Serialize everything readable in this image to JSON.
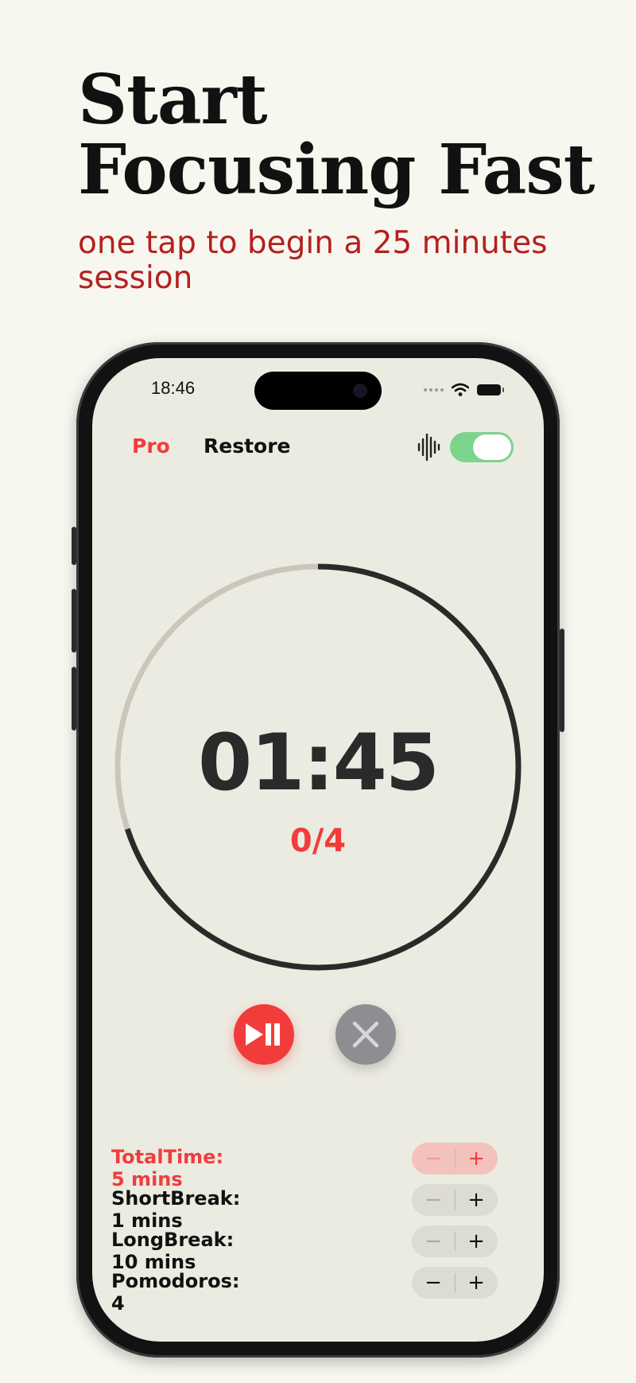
{
  "headline": "Start\nFocusing Fast",
  "subhead": "one tap to begin a 25 minutes session",
  "status": {
    "time": "18:46"
  },
  "topbar": {
    "pro_label": "Pro",
    "restore_label": "Restore",
    "sound_toggle_on": true
  },
  "timer": {
    "time": "01:45",
    "session_counter": "0/4",
    "progress_fraction": 0.7
  },
  "controls": {
    "play_pause_icon": "play-pause-icon",
    "stop_icon": "close-icon"
  },
  "settings": [
    {
      "label": "TotalTime:  5 mins",
      "active": true
    },
    {
      "label": "ShortBreak:  1 mins",
      "active": false
    },
    {
      "label": "LongBreak:  10 mins",
      "active": false
    },
    {
      "label": "Pomodoros:  4",
      "active": false
    }
  ],
  "colors": {
    "accent": "#f23c3c",
    "headline_sub": "#b5201f",
    "toggle": "#7bd48b",
    "screen_bg": "#ecebe1"
  }
}
